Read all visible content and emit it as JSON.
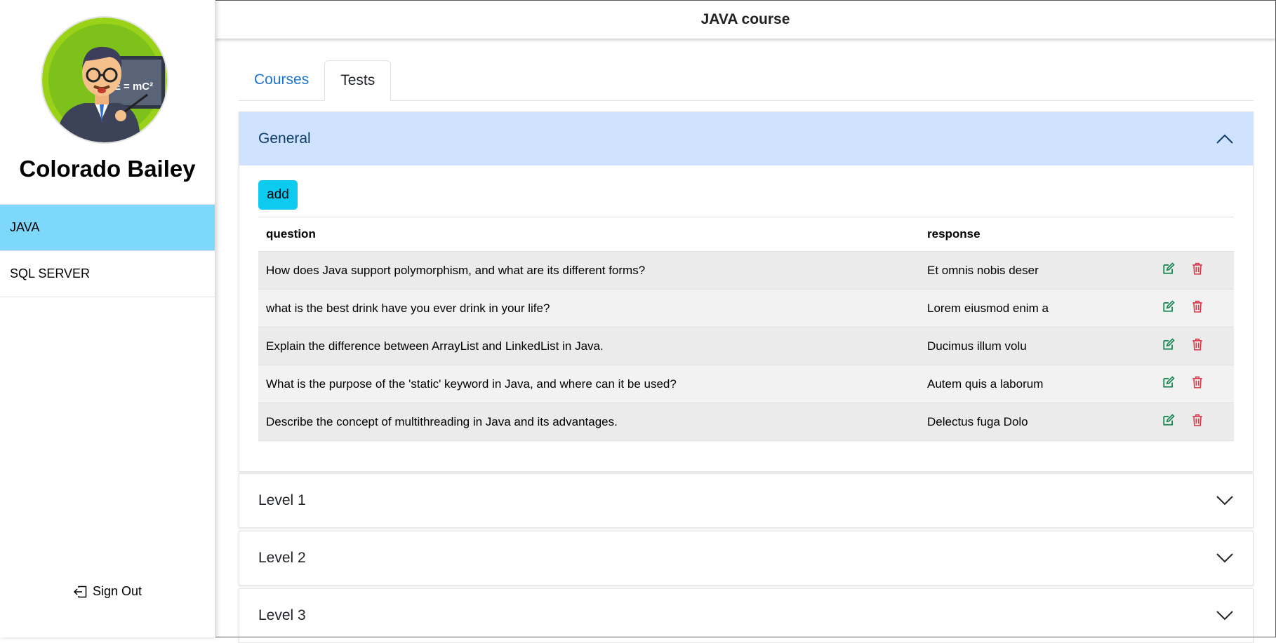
{
  "header": {
    "title": "JAVA course"
  },
  "sidebar": {
    "user_name": "Colorado Bailey",
    "avatar_formula": "E = mC²",
    "items": [
      {
        "label": "JAVA",
        "active": true
      },
      {
        "label": "SQL SERVER",
        "active": false
      }
    ],
    "signout_label": "Sign Out"
  },
  "tabs": [
    {
      "label": "Courses",
      "active": false
    },
    {
      "label": "Tests",
      "active": true
    }
  ],
  "accordion": [
    {
      "label": "General",
      "open": true
    },
    {
      "label": "Level 1",
      "open": false
    },
    {
      "label": "Level 2",
      "open": false
    },
    {
      "label": "Level 3",
      "open": false
    }
  ],
  "general": {
    "add_label": "add",
    "columns": {
      "question": "question",
      "response": "response"
    },
    "rows": [
      {
        "question": "How does Java support polymorphism, and what are its different forms?",
        "response": "Et omnis nobis deser"
      },
      {
        "question": "what is the best drink have you ever drink in your life?",
        "response": "Lorem eiusmod enim a"
      },
      {
        "question": "Explain the difference between ArrayList and LinkedList in Java.",
        "response": "Ducimus illum volu"
      },
      {
        "question": "What is the purpose of the 'static' keyword in Java, and where can it be used?",
        "response": "Autem quis a laborum"
      },
      {
        "question": "Describe the concept of multithreading in Java and its advantages.",
        "response": "Delectus fuga Dolo"
      }
    ]
  },
  "colors": {
    "active_nav": "#7dd8fc",
    "accordion_open": "#cfe2ff",
    "add_button": "#0dcaf0",
    "edit_icon": "#198754",
    "delete_icon": "#dc3545",
    "tab_link": "#1a73d1"
  },
  "icons": {
    "edit": "pencil-square-icon",
    "delete": "trash-icon",
    "expand": "chevron-down-icon",
    "collapse": "chevron-up-icon",
    "signout": "box-arrow-left-icon"
  }
}
